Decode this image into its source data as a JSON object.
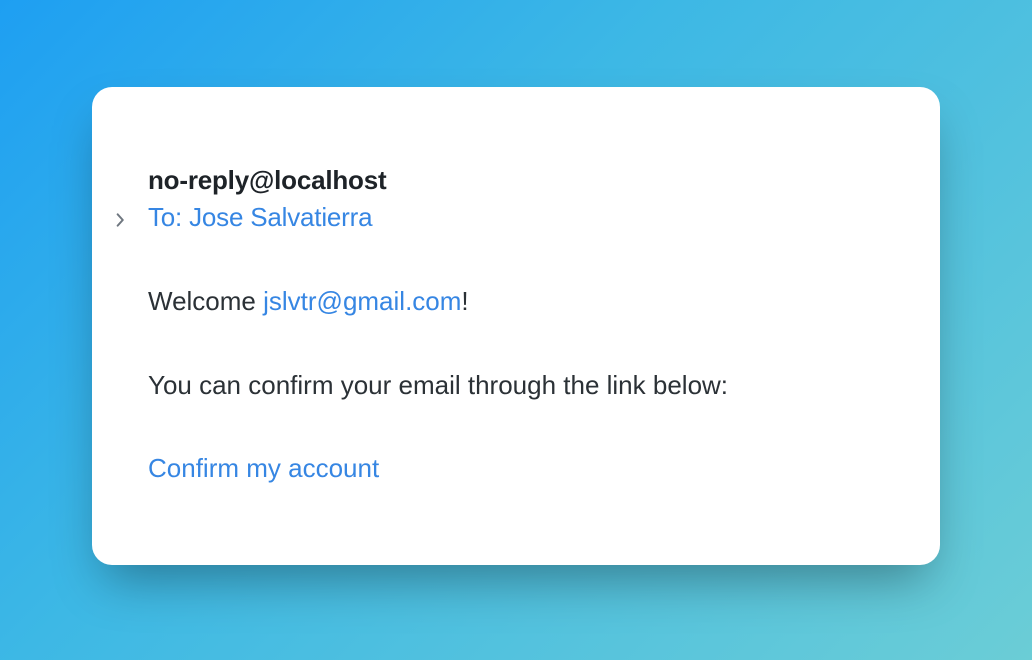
{
  "header": {
    "from": "no-reply@localhost",
    "to_prefix": "To: ",
    "to_name": "Jose Salvatierra"
  },
  "body": {
    "welcome_prefix": "Welcome ",
    "recipient_email": "jslvtr@gmail.com",
    "welcome_suffix": "!",
    "confirm_text": "You can confirm your email through the link below:",
    "confirm_link_label": "Confirm my account"
  }
}
